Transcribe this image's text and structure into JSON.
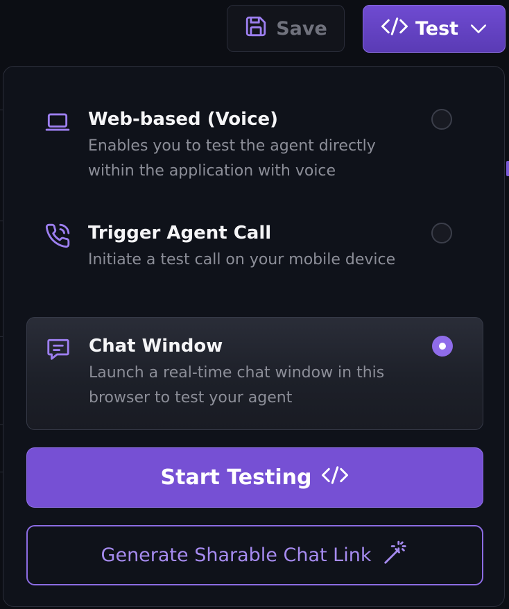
{
  "toolbar": {
    "save_label": "Save",
    "test_label": "Test"
  },
  "options": [
    {
      "title": "Web-based (Voice)",
      "description": "Enables you to test the agent directly within the application with voice",
      "icon": "laptop-icon",
      "selected": false
    },
    {
      "title": "Trigger Agent Call",
      "description": "Initiate a test call on your mobile device",
      "icon": "phone-call-icon",
      "selected": false
    },
    {
      "title": "Chat Window",
      "description": "Launch a real-time chat window in this browser to test your agent",
      "icon": "chat-icon",
      "selected": true
    }
  ],
  "actions": {
    "start_label": "Start Testing",
    "share_label": "Generate Sharable Chat Link"
  },
  "colors": {
    "accent": "#7650d4",
    "accent_light": "#9d7ff0",
    "panel_bg": "#0f121a",
    "background": "#0c0e14"
  }
}
